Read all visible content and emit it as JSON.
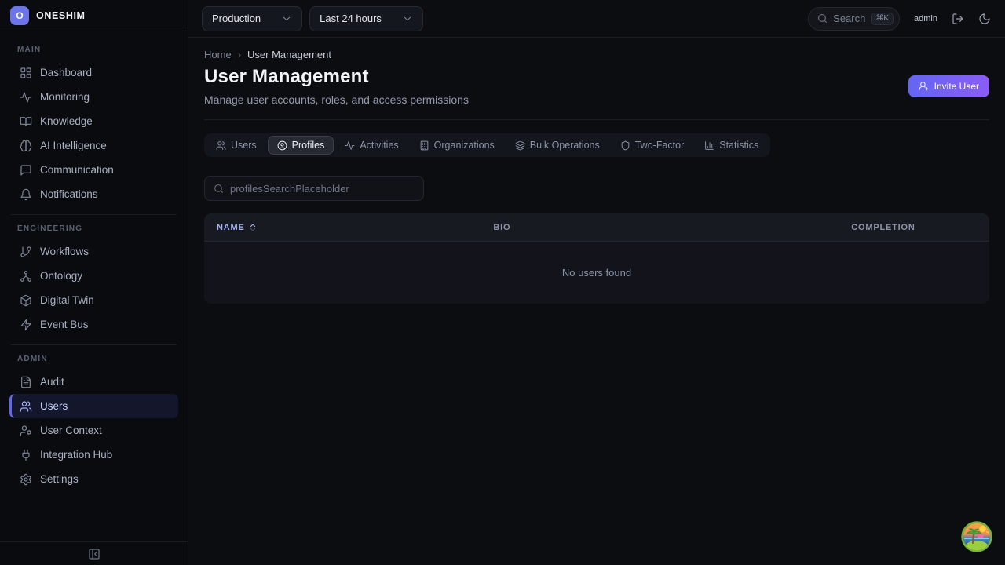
{
  "brand": {
    "name": "ONESHIM",
    "logo_letter": "O"
  },
  "sidebar": {
    "sections": [
      {
        "label": "Main",
        "items": [
          {
            "label": "Dashboard",
            "icon": "dashboard-icon"
          },
          {
            "label": "Monitoring",
            "icon": "monitoring-icon"
          },
          {
            "label": "Knowledge",
            "icon": "knowledge-icon"
          },
          {
            "label": "AI Intelligence",
            "icon": "ai-intelligence-icon"
          },
          {
            "label": "Communication",
            "icon": "communication-icon"
          },
          {
            "label": "Notifications",
            "icon": "notifications-icon"
          }
        ]
      },
      {
        "label": "Engineering",
        "items": [
          {
            "label": "Workflows",
            "icon": "workflows-icon"
          },
          {
            "label": "Ontology",
            "icon": "ontology-icon"
          },
          {
            "label": "Digital Twin",
            "icon": "digital-twin-icon"
          },
          {
            "label": "Event Bus",
            "icon": "event-bus-icon"
          }
        ]
      },
      {
        "label": "Admin",
        "items": [
          {
            "label": "Audit",
            "icon": "audit-icon"
          },
          {
            "label": "Users",
            "icon": "users-icon",
            "active": true
          },
          {
            "label": "User Context",
            "icon": "user-context-icon"
          },
          {
            "label": "Integration Hub",
            "icon": "integration-hub-icon"
          },
          {
            "label": "Settings",
            "icon": "settings-icon"
          }
        ]
      }
    ]
  },
  "topbar": {
    "environment": "Production",
    "time_range": "Last 24 hours",
    "search_label": "Search",
    "search_shortcut": "⌘K",
    "username": "admin"
  },
  "page": {
    "breadcrumb": {
      "home": "Home",
      "separator": "›",
      "current": "User Management"
    },
    "title": "User Management",
    "subtitle": "Manage user accounts, roles, and access permissions",
    "invite_button_label": "Invite User"
  },
  "tabs": [
    {
      "label": "Users",
      "icon": "users-icon"
    },
    {
      "label": "Profiles",
      "icon": "profile-icon",
      "active": true
    },
    {
      "label": "Activities",
      "icon": "activity-icon"
    },
    {
      "label": "Organizations",
      "icon": "organization-icon"
    },
    {
      "label": "Bulk Operations",
      "icon": "layers-icon"
    },
    {
      "label": "Two-Factor",
      "icon": "shield-icon"
    },
    {
      "label": "Statistics",
      "icon": "statistics-icon"
    }
  ],
  "profiles_panel": {
    "search_placeholder": "profilesSearchPlaceholder",
    "table": {
      "columns": [
        {
          "label": "NAME",
          "icon": "sort-icon",
          "active": true
        },
        {
          "label": "BIO"
        },
        {
          "label": "COMPLETION"
        }
      ],
      "rows": [],
      "empty_message": "No users found"
    }
  },
  "colors": {
    "accent_indigo": "#6366f1",
    "accent_purple": "#8b5cf6",
    "active_nav_text": "#c7d2fe",
    "sorted_column": "#a7b0f2",
    "background": "#0c0d11"
  }
}
